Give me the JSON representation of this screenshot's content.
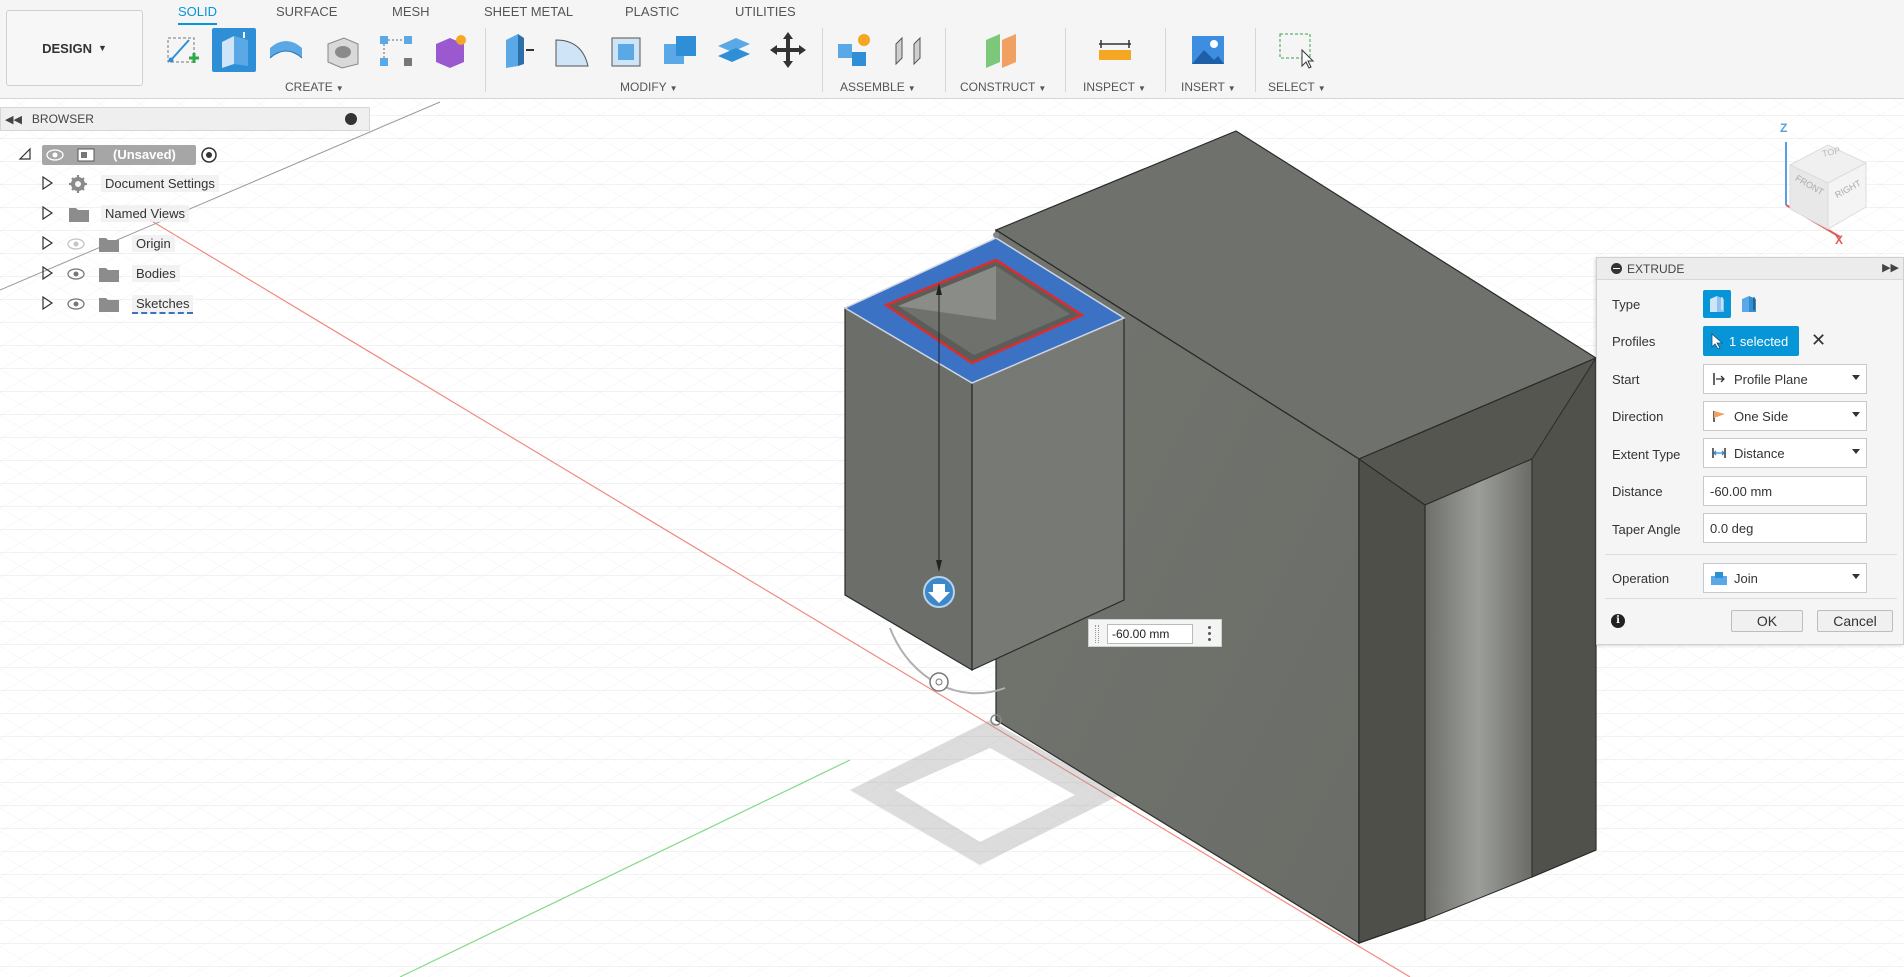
{
  "app": {
    "workspace_label": "DESIGN"
  },
  "toolbar": {
    "tabs": [
      "SOLID",
      "SURFACE",
      "MESH",
      "SHEET METAL",
      "PLASTIC",
      "UTILITIES"
    ],
    "active_tab": "SOLID",
    "groups": [
      "CREATE",
      "MODIFY",
      "ASSEMBLE",
      "CONSTRUCT",
      "INSPECT",
      "INSERT",
      "SELECT"
    ],
    "icons": {
      "create": [
        "create-sketch-icon",
        "extrude-icon",
        "revolve-icon",
        "hole-icon",
        "pattern-icon",
        "create-form-icon"
      ],
      "modify": [
        "press-pull-icon",
        "fillet-icon",
        "shell-icon",
        "combine-icon",
        "offset-face-icon",
        "move-icon"
      ],
      "assemble": [
        "new-component-icon",
        "joint-icon"
      ],
      "construct": [
        "offset-plane-icon"
      ],
      "inspect": [
        "measure-icon"
      ],
      "insert": [
        "insert-image-icon"
      ],
      "select": [
        "window-select-icon"
      ]
    }
  },
  "browser": {
    "title": "BROWSER",
    "root_label": "(Unsaved)",
    "nodes": [
      {
        "label": "Document Settings",
        "icon": "gear-icon"
      },
      {
        "label": "Named Views",
        "icon": "folder-icon"
      },
      {
        "label": "Origin",
        "icon": "folder-icon",
        "visibility": "hidden"
      },
      {
        "label": "Bodies",
        "icon": "folder-icon",
        "visibility": "visible"
      },
      {
        "label": "Sketches",
        "icon": "folder-icon",
        "visibility": "visible"
      }
    ]
  },
  "viewport": {
    "dimension_label": "60.00",
    "distance_input": "-60.00 mm",
    "view_cube": {
      "faces": [
        "TOP",
        "FRONT",
        "RIGHT"
      ],
      "axes": [
        "Z",
        "X"
      ]
    }
  },
  "extrude_dialog": {
    "title": "EXTRUDE",
    "labels": {
      "type": "Type",
      "profiles": "Profiles",
      "start": "Start",
      "direction": "Direction",
      "extent_type": "Extent Type",
      "distance": "Distance",
      "taper_angle": "Taper Angle",
      "operation": "Operation"
    },
    "profiles_selected": "1 selected",
    "start": "Profile Plane",
    "direction": "One Side",
    "extent_type": "Distance",
    "distance": "-60.00 mm",
    "taper_angle": "0.0 deg",
    "operation": "Join",
    "ok_label": "OK",
    "cancel_label": "Cancel"
  },
  "colors": {
    "accent": "#0696d7",
    "selection_blue": "#3b72c4",
    "profile_red": "#e02b2b",
    "body_gray": "#6b6d6a"
  }
}
